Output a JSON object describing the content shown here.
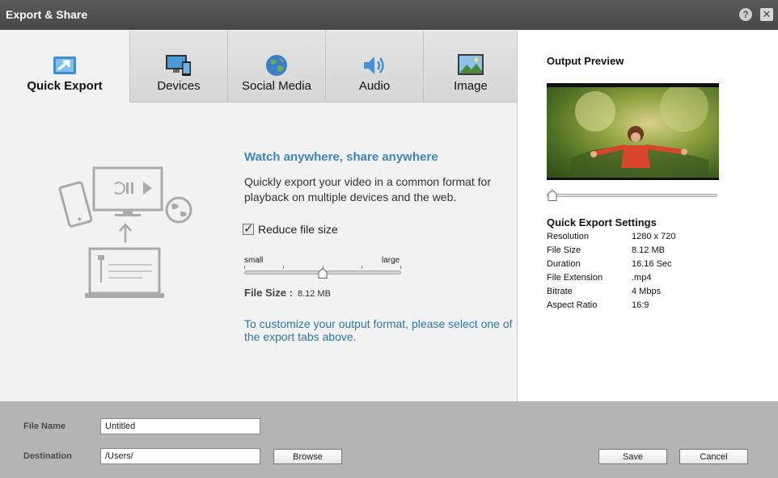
{
  "window": {
    "title": "Export & Share",
    "help_icon": "?",
    "close_icon": "✕"
  },
  "tabs": [
    {
      "label": "Quick Export",
      "icon": "quick-export-icon",
      "active": true
    },
    {
      "label": "Devices",
      "icon": "devices-icon"
    },
    {
      "label": "Social Media",
      "icon": "globe-icon"
    },
    {
      "label": "Audio",
      "icon": "speaker-icon"
    },
    {
      "label": "Image",
      "icon": "image-icon"
    }
  ],
  "main": {
    "heading": "Watch anywhere, share anywhere",
    "description": "Quickly export your video in a common format for playback on multiple devices and the web.",
    "reduce_label": "Reduce file size",
    "reduce_checked": true,
    "slider_small": "small",
    "slider_large": "large",
    "slider_value": 0.5,
    "file_size_label": "File Size :",
    "file_size_value": "8.12 MB",
    "customize_text": "To customize your output format, please select one of the export tabs above."
  },
  "preview": {
    "title": "Output Preview",
    "position": 0.0
  },
  "settings": {
    "title": "Quick Export Settings",
    "rows": [
      {
        "key": "Resolution",
        "value": "1280 x 720"
      },
      {
        "key": "File Size",
        "value": "8.12 MB"
      },
      {
        "key": "Duration",
        "value": "16.16 Sec"
      },
      {
        "key": "File Extension",
        "value": ".mp4"
      },
      {
        "key": "Bitrate",
        "value": "4 Mbps"
      },
      {
        "key": "Aspect Ratio",
        "value": "16:9"
      }
    ]
  },
  "bottom": {
    "file_name_label": "File Name",
    "file_name_value": "Untitled",
    "destination_label": "Destination",
    "destination_value": "/Users/",
    "browse_label": "Browse",
    "save_label": "Save",
    "cancel_label": "Cancel"
  },
  "colors": {
    "accent_heading": "#3a87c0",
    "link_text": "#2a77b0",
    "titlebar": "#4d4d4d"
  }
}
